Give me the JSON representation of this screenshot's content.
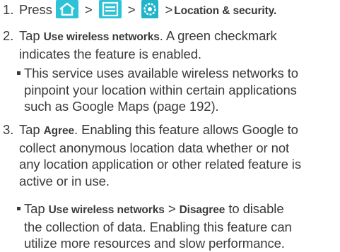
{
  "steps": [
    {
      "number": "1.",
      "prefix": "Press",
      "separator": ">",
      "icons": [
        "home-icon",
        "menu-icon",
        "settings-icon"
      ],
      "target": "Location & security."
    },
    {
      "number": "2.",
      "line1_pre": "Tap",
      "line1_bold": "Use wireless networks",
      "line1_post": ". A green checkmark",
      "line2": "indicates the feature is enabled.",
      "bullets": [
        {
          "lines": [
            "This service uses available wireless networks to",
            "pinpoint your location within certain applications",
            "such as Google Maps (page 192)."
          ]
        }
      ]
    },
    {
      "number": "3.",
      "line1_pre": "Tap",
      "line1_bold": "Agree",
      "line1_post": ". Enabling this feature allows Google to",
      "line2": "collect anonymous location data whether or not",
      "line3": "any location application or other related feature is",
      "line4": "active or in use.",
      "bullets": [
        {
          "pre": "Tap",
          "bold1": "Use wireless networks",
          "separator": ">",
          "bold2": "Disagree",
          "post": "to disable",
          "lines": [
            "the collection of data. Enabling this feature can",
            "utilize more resources and slow performance."
          ]
        }
      ]
    }
  ],
  "colors": {
    "text": "#3a3a3a",
    "icon_background": "#2cc3d6",
    "icon_glyph": "#ffffff"
  }
}
